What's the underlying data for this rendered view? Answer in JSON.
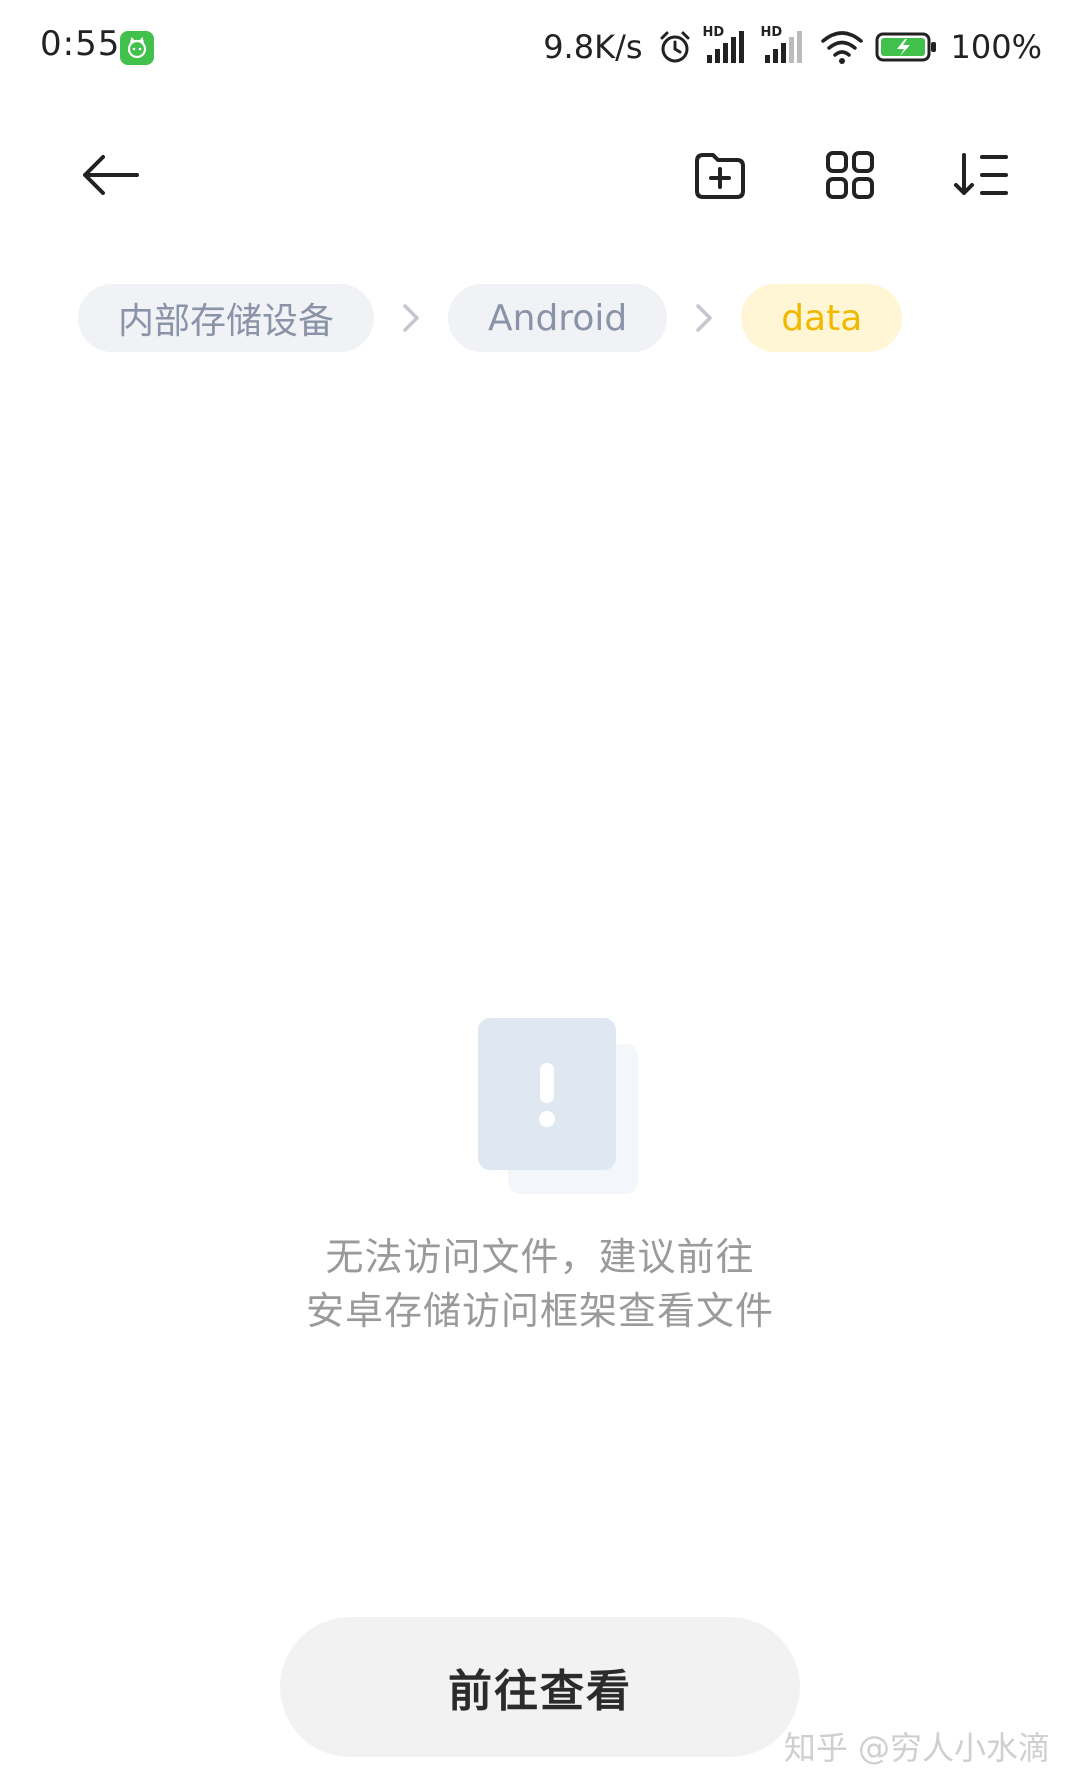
{
  "status_bar": {
    "time": "0:55",
    "app_icon": "green-cat-app-icon",
    "net_speed": "9.8K/s",
    "alarm_icon": "alarm-clock-icon",
    "signal_label": "HD",
    "signal_icons": [
      "signal-hd-icon",
      "signal-hd-icon"
    ],
    "wifi_icon": "wifi-icon",
    "battery_icon": "battery-charging-icon",
    "battery_percent": "100%"
  },
  "toolbar": {
    "back_icon": "back-arrow-icon",
    "new_folder_icon": "new-folder-icon",
    "grid_view_icon": "grid-view-icon",
    "sort_icon": "sort-icon"
  },
  "breadcrumb": {
    "items": [
      {
        "label": "内部存储设备",
        "active": false
      },
      {
        "label": "Android",
        "active": false
      },
      {
        "label": "data",
        "active": true
      }
    ],
    "separator_icon": "chevron-right-icon"
  },
  "empty_state": {
    "icon": "warning-document-icon",
    "line1": "无法访问文件，建议前往",
    "line2": "安卓存储访问框架查看文件"
  },
  "action": {
    "go_label": "前往查看"
  },
  "watermark": "知乎 @穷人小水滴",
  "colors": {
    "crumb_bg": "#f0f2f6",
    "crumb_text": "#8a93a8",
    "active_crumb_bg": "#fff6d6",
    "active_crumb_text": "#f1b800",
    "battery_green": "#41c04c"
  }
}
